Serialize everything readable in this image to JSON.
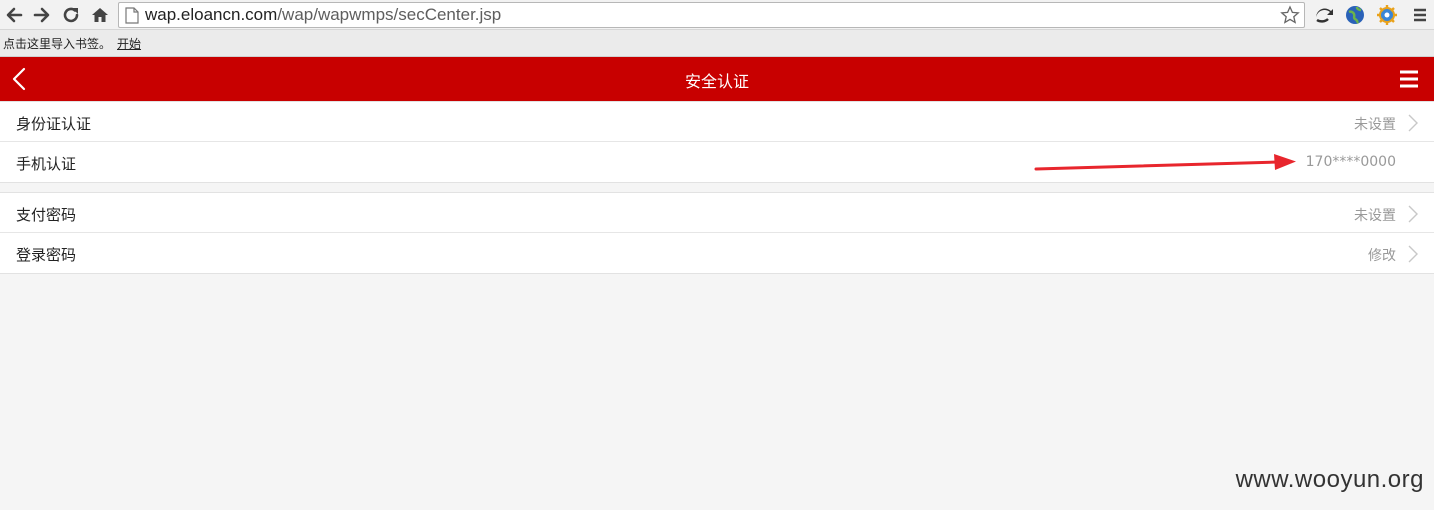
{
  "browser": {
    "url_host": "wap.eloancn.com",
    "url_path": "/wap/wapwmps/secCenter.jsp",
    "icons": [
      "back-icon",
      "forward-icon",
      "reload-icon",
      "home-icon",
      "page-icon",
      "star-icon",
      "extension-icon",
      "globe-icon",
      "settings-gear-icon",
      "menu-icon"
    ]
  },
  "bookmarks": {
    "hint": "点击这里导入书签。",
    "start_link": "开始"
  },
  "header": {
    "title": "安全认证",
    "accent_color": "#c80000"
  },
  "groups": [
    {
      "rows": [
        {
          "label": "身份证认证",
          "value": "未设置"
        },
        {
          "label": "手机认证",
          "value": "170****0000"
        }
      ]
    },
    {
      "rows": [
        {
          "label": "支付密码",
          "value": "未设置"
        },
        {
          "label": "登录密码",
          "value": "修改"
        }
      ]
    }
  ],
  "watermark": "www.wooyun.org"
}
